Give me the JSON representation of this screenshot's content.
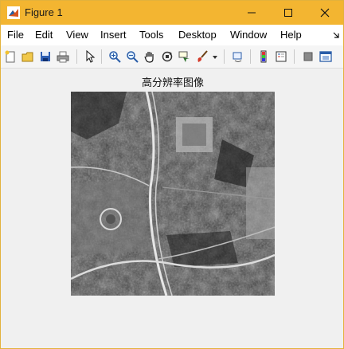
{
  "window": {
    "title": "Figure 1"
  },
  "menu": [
    {
      "label": "File"
    },
    {
      "label": "Edit"
    },
    {
      "label": "View"
    },
    {
      "label": "Insert"
    },
    {
      "label": "Tools"
    },
    {
      "label": "Desktop"
    },
    {
      "label": "Window"
    },
    {
      "label": "Help"
    }
  ],
  "toolbar": {
    "buttons": [
      "new-figure-icon",
      "open-file-icon",
      "save-icon",
      "print-icon",
      "edit-plot-icon",
      "zoom-in-icon",
      "zoom-out-icon",
      "pan-icon",
      "rotate-3d-icon",
      "data-cursor-icon",
      "brush-icon",
      "link-plot-icon",
      "insert-colorbar-icon",
      "insert-legend-icon",
      "hide-plot-tools-icon",
      "show-plot-tools-icon"
    ]
  },
  "figure": {
    "title": "高分辨率图像",
    "image_description_color": "#3a3a3a"
  },
  "colors": {
    "titlebar": "#f3b531",
    "window_bg": "#f0f0f0"
  }
}
